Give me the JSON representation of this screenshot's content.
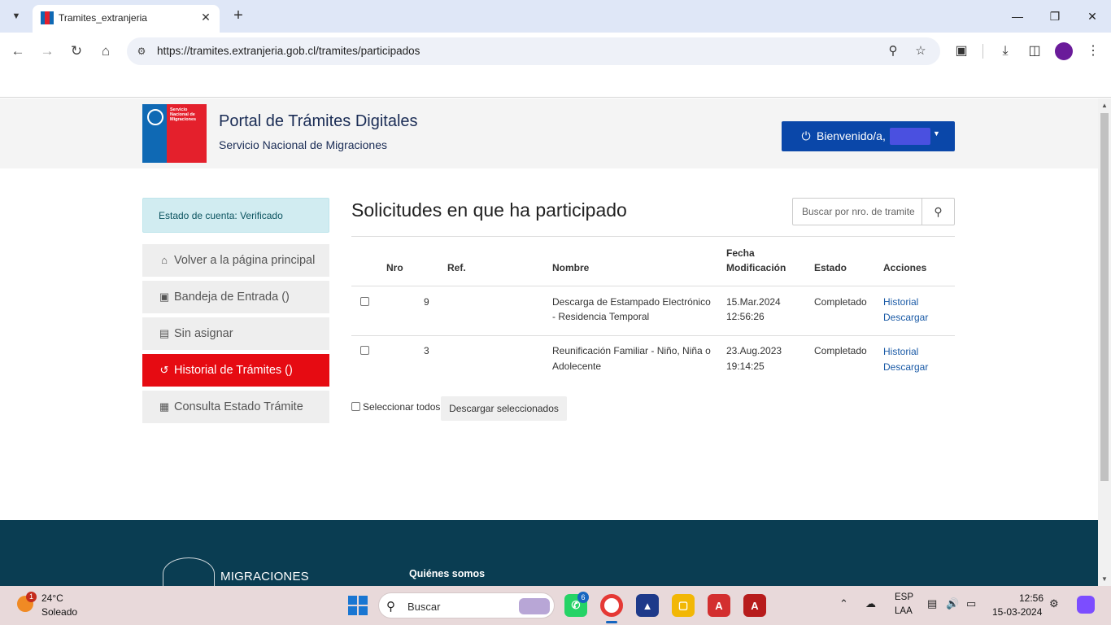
{
  "browser": {
    "tab_title": "Tramites_extranjeria",
    "url": "https://tramites.extranjeria.gob.cl/tramites/participados",
    "favicon_colors": [
      "#0f69b4",
      "#e4202c"
    ],
    "profile_color": "#6a1b9a"
  },
  "header": {
    "logo_text": "Servicio Nacional de Migraciones",
    "title": "Portal de Trámites Digitales",
    "subtitle": "Servicio Nacional de Migraciones",
    "welcome_label": "Bienvenido/a,",
    "accent_color": "#0a47a9"
  },
  "sidebar": {
    "account_status": "Estado de cuenta: Verificado",
    "items": [
      {
        "label": "Volver a la página principal",
        "icon": "home-icon",
        "active": false
      },
      {
        "label": "Bandeja de Entrada ()",
        "icon": "inbox-icon",
        "active": false
      },
      {
        "label": "Sin asignar",
        "icon": "clipboard-icon",
        "active": false
      },
      {
        "label": "Historial de Trámites ()",
        "icon": "history-icon",
        "active": true
      },
      {
        "label": "Consulta Estado Trámite",
        "icon": "document-icon",
        "active": false
      }
    ],
    "active_color": "#e60b12"
  },
  "main": {
    "title": "Solicitudes en que ha participado",
    "search_placeholder": "Buscar por nro. de tramite",
    "columns": {
      "nro": "Nro",
      "ref": "Ref.",
      "nombre": "Nombre",
      "fecha_1": "Fecha",
      "fecha_2": "Modificación",
      "estado": "Estado",
      "acciones": "Acciones"
    },
    "rows": [
      {
        "nro": "9",
        "ref": "",
        "nombre_1": "Descarga de Estampado Electrónico",
        "nombre_2": "- Residencia Temporal",
        "fecha_1": "15.Mar.2024",
        "fecha_2": "12:56:26",
        "estado": "Completado",
        "accion_1": "Historial",
        "accion_2": "Descargar"
      },
      {
        "nro": "3",
        "ref": "",
        "nombre_1": "Reunificación Familiar - Niño, Niña o",
        "nombre_2": "Adolecente",
        "fecha_1": "23.Aug.2023",
        "fecha_2": "19:14:25",
        "estado": "Completado",
        "accion_1": "Historial",
        "accion_2": "Descargar"
      }
    ],
    "select_all_label": "Seleccionar todos",
    "download_selected_label": "Descargar seleccionados"
  },
  "footer": {
    "brand": "MIGRACIONES",
    "link": "Quiénes somos",
    "background_color": "#0a3d52"
  },
  "taskbar": {
    "weather_temp": "24°C",
    "weather_desc": "Soleado",
    "weather_badge": "1",
    "search_placeholder": "Buscar",
    "whatsapp_badge": "6",
    "lang_1": "ESP",
    "lang_2": "LAA",
    "time": "12:56",
    "date": "15-03-2024"
  }
}
